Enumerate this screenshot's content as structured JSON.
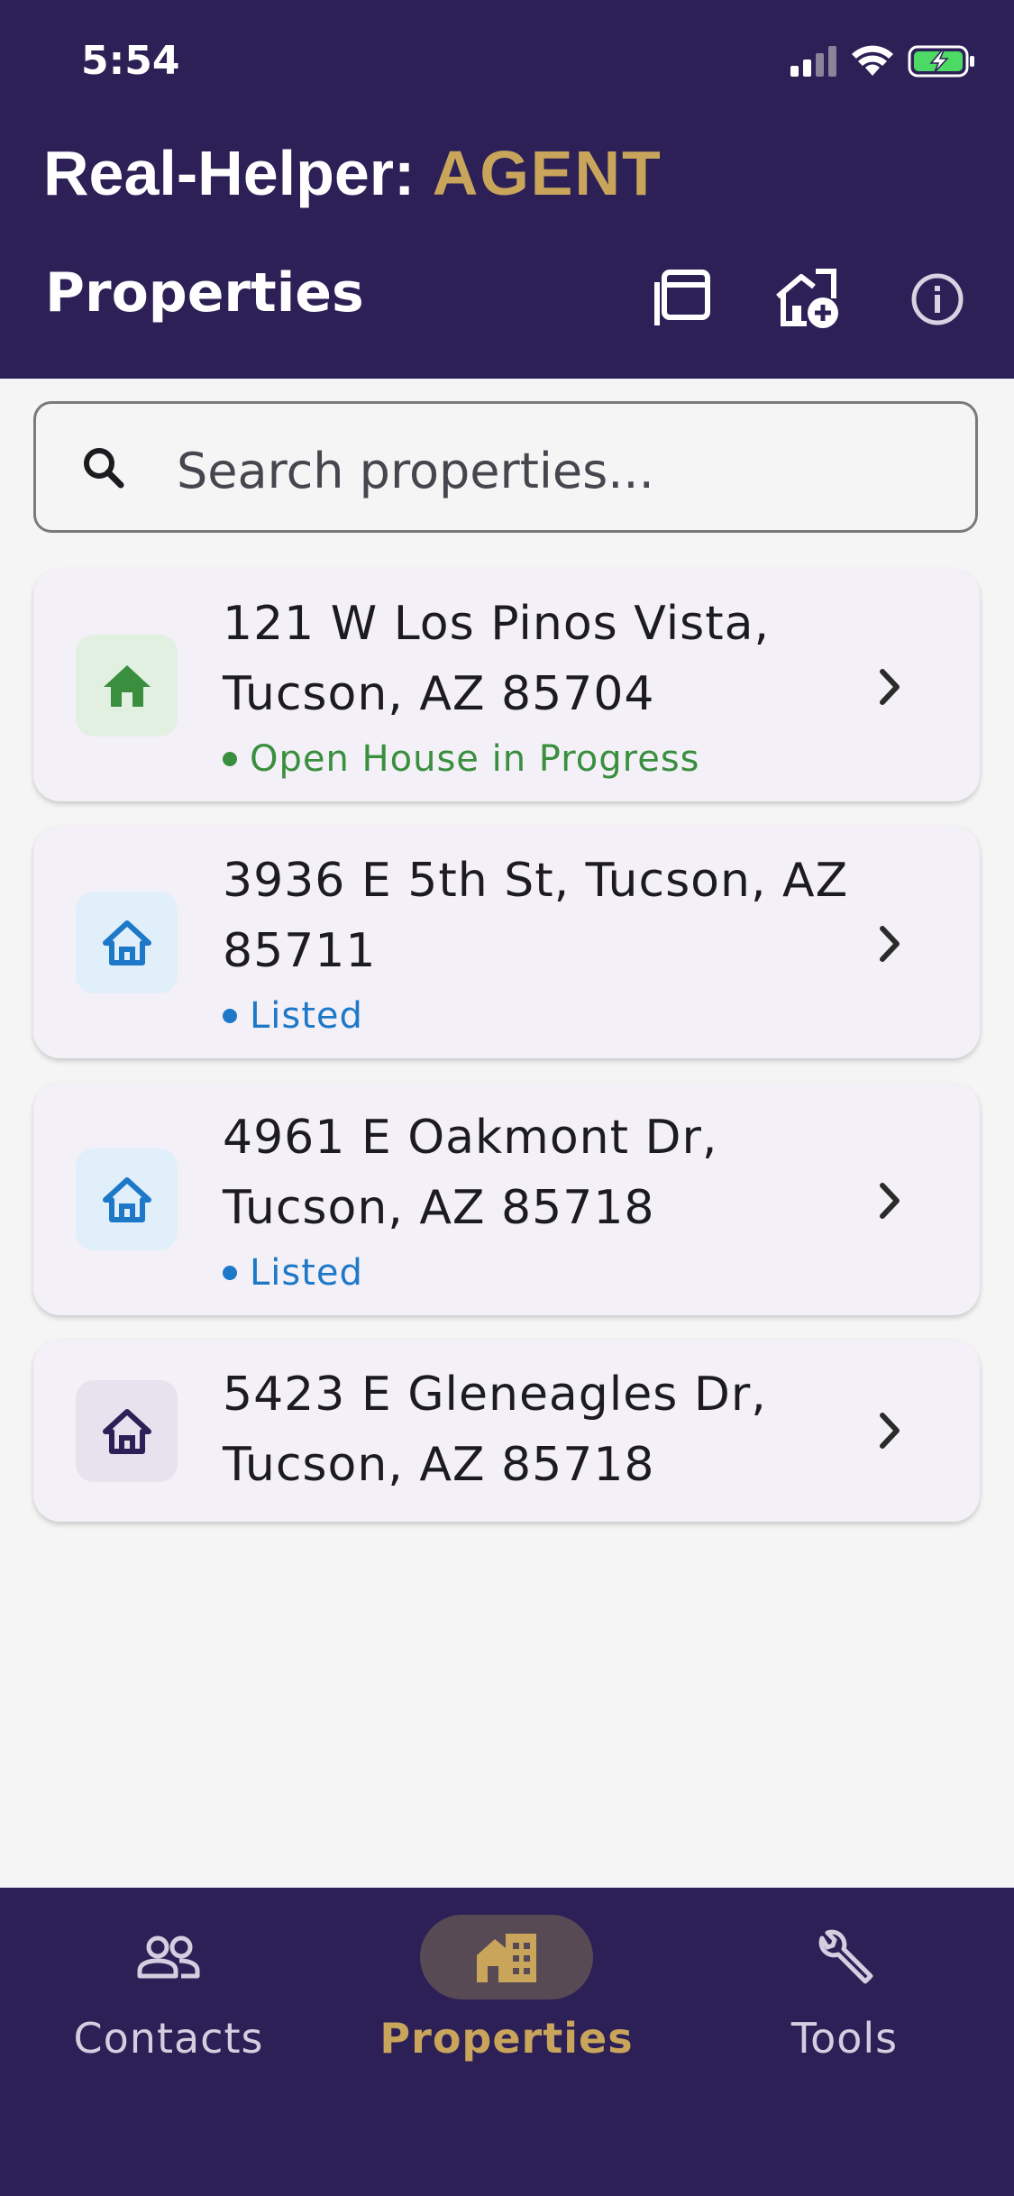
{
  "status_bar": {
    "time": "5:54"
  },
  "header": {
    "app_name": "Real-Helper:",
    "app_role": "AGENT",
    "page_title": "Properties"
  },
  "search": {
    "placeholder": "Search properties..."
  },
  "properties": [
    {
      "address": "121 W Los Pinos Vista, Tucson, AZ 85704",
      "status": "Open House in Progress",
      "status_color": "#3a8f3f"
    },
    {
      "address": "3936 E 5th St, Tucson, AZ 85711",
      "status": "Listed",
      "status_color": "#1e78c8"
    },
    {
      "address": "4961 E Oakmont Dr, Tucson, AZ 85718",
      "status": "Listed",
      "status_color": "#1e78c8"
    },
    {
      "address": "5423 E Gleneagles Dr, Tucson, AZ 85718",
      "status": "",
      "status_color": ""
    }
  ],
  "bottom_nav": {
    "items": [
      {
        "label": "Contacts",
        "icon": "people-icon"
      },
      {
        "label": "Properties",
        "icon": "building-icon",
        "active": true
      },
      {
        "label": "Tools",
        "icon": "wrench-icon"
      }
    ]
  },
  "colors": {
    "primary": "#2c2056",
    "accent": "#c9a55c",
    "background": "#f5f5f5"
  }
}
